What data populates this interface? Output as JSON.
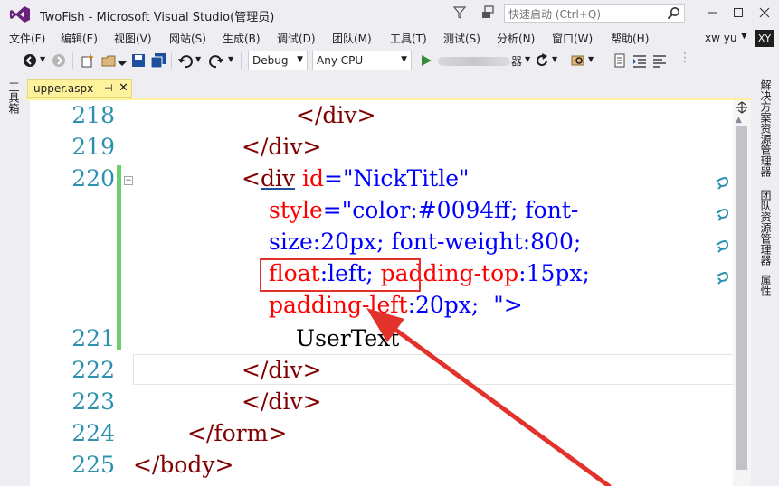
{
  "window": {
    "title": "TwoFish - Microsoft Visual Studio(管理员)",
    "quicklaunch_placeholder": "快速启动 (Ctrl+Q)"
  },
  "menu": [
    "文件(F)",
    "编辑(E)",
    "视图(V)",
    "网站(S)",
    "生成(B)",
    "调试(D)",
    "团队(M)",
    "工具(T)",
    "测试(S)",
    "分析(N)",
    "窗口(W)",
    "帮助(H)"
  ],
  "user": {
    "name": "xw yu",
    "initials": "XY"
  },
  "toolbar": {
    "config": "Debug",
    "platform": "Any CPU"
  },
  "side_panels": {
    "left": "工具箱",
    "right": [
      "解决方案资源管理器",
      "团队资源管理器",
      "属性"
    ]
  },
  "tab": {
    "name": "upper.aspx",
    "pin": "⊣",
    "close": "✕"
  },
  "editor": {
    "line_numbers": [
      "218",
      "219",
      "220",
      "221",
      "222",
      "223",
      "224",
      "225"
    ],
    "code": {
      "l218_tag": "</div>",
      "l219_tag": "</div>",
      "l220_open": "<",
      "l220_div": "div",
      "l220_attr": " id",
      "l220_eq": "=",
      "l220_val": "\"NickTitle\"",
      "w1_attr": "style",
      "w1_eq": "=",
      "w1_val": "\"color:#0094ff; font-",
      "w2_val": "size:20px; font-weight:800;",
      "w3_a": "float",
      "w3_b": ":left;",
      "w3_c": " padding-top",
      "w3_d": ":15px;",
      "w4_a": "padding-left",
      "w4_b": ":20px;  ",
      "w4_c": "\">",
      "l221_text": "UserText",
      "l222_tag": "</div>",
      "l223_tag": "</div>",
      "l224_tag": "</form>",
      "l225_tag": "</body>"
    }
  },
  "colors": {
    "line_number": "#2b91af",
    "tag": "#800000",
    "attribute": "#ff0000",
    "value": "#0000ff",
    "highlight": "#e2322b",
    "tab": "#fff29d"
  }
}
